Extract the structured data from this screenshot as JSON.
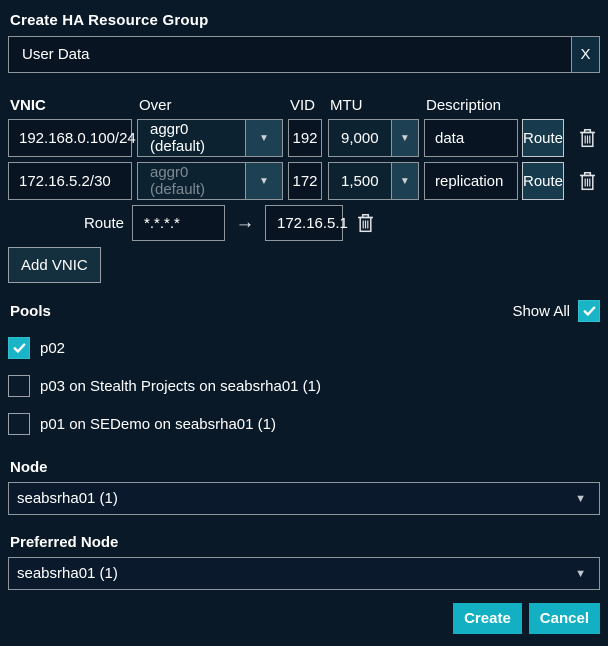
{
  "dialog": {
    "title": "Create HA Resource Group"
  },
  "name_field": {
    "value": "User Data",
    "clear_label": "X"
  },
  "vnic_table": {
    "headers": {
      "vnic": "VNIC",
      "over": "Over",
      "vid": "VID",
      "mtu": "MTU",
      "description": "Description"
    },
    "rows": [
      {
        "vnic": "192.168.0.100/24",
        "over": "aggr0 (default)",
        "vid": "192",
        "mtu": "9,000",
        "description": "data",
        "route_label": "Route"
      },
      {
        "vnic": "172.16.5.2/30",
        "over": "aggr0 (default)",
        "vid": "172",
        "mtu": "1,500",
        "description": "replication",
        "route_label": "Route"
      }
    ],
    "route_row": {
      "label": "Route",
      "destination": "*.*.*.*",
      "gateway": "172.16.5.1"
    },
    "add_button_label": "Add VNIC"
  },
  "pools": {
    "label": "Pools",
    "show_all_label": "Show All",
    "show_all_checked": true,
    "items": [
      {
        "label": "p02",
        "checked": true
      },
      {
        "label": "p03 on Stealth Projects on seabsrha01 (1)",
        "checked": false
      },
      {
        "label": "p01 on SEDemo on seabsrha01 (1)",
        "checked": false
      }
    ]
  },
  "node": {
    "label": "Node",
    "value": "seabsrha01 (1)"
  },
  "preferred_node": {
    "label": "Preferred Node",
    "value": "seabsrha01 (1)"
  },
  "actions": {
    "create": "Create",
    "cancel": "Cancel"
  },
  "icons": {
    "dropdown": "▼",
    "arrow_right": "→"
  },
  "colors": {
    "background": "#0a1928",
    "input_background": "#081422",
    "border_gray": "#8f969c",
    "teal_segment": "#1d4153",
    "accent_cyan": "#12b0c2",
    "checkbox_cyan": "#19b4c6",
    "disabled_text": "#7e8992"
  }
}
